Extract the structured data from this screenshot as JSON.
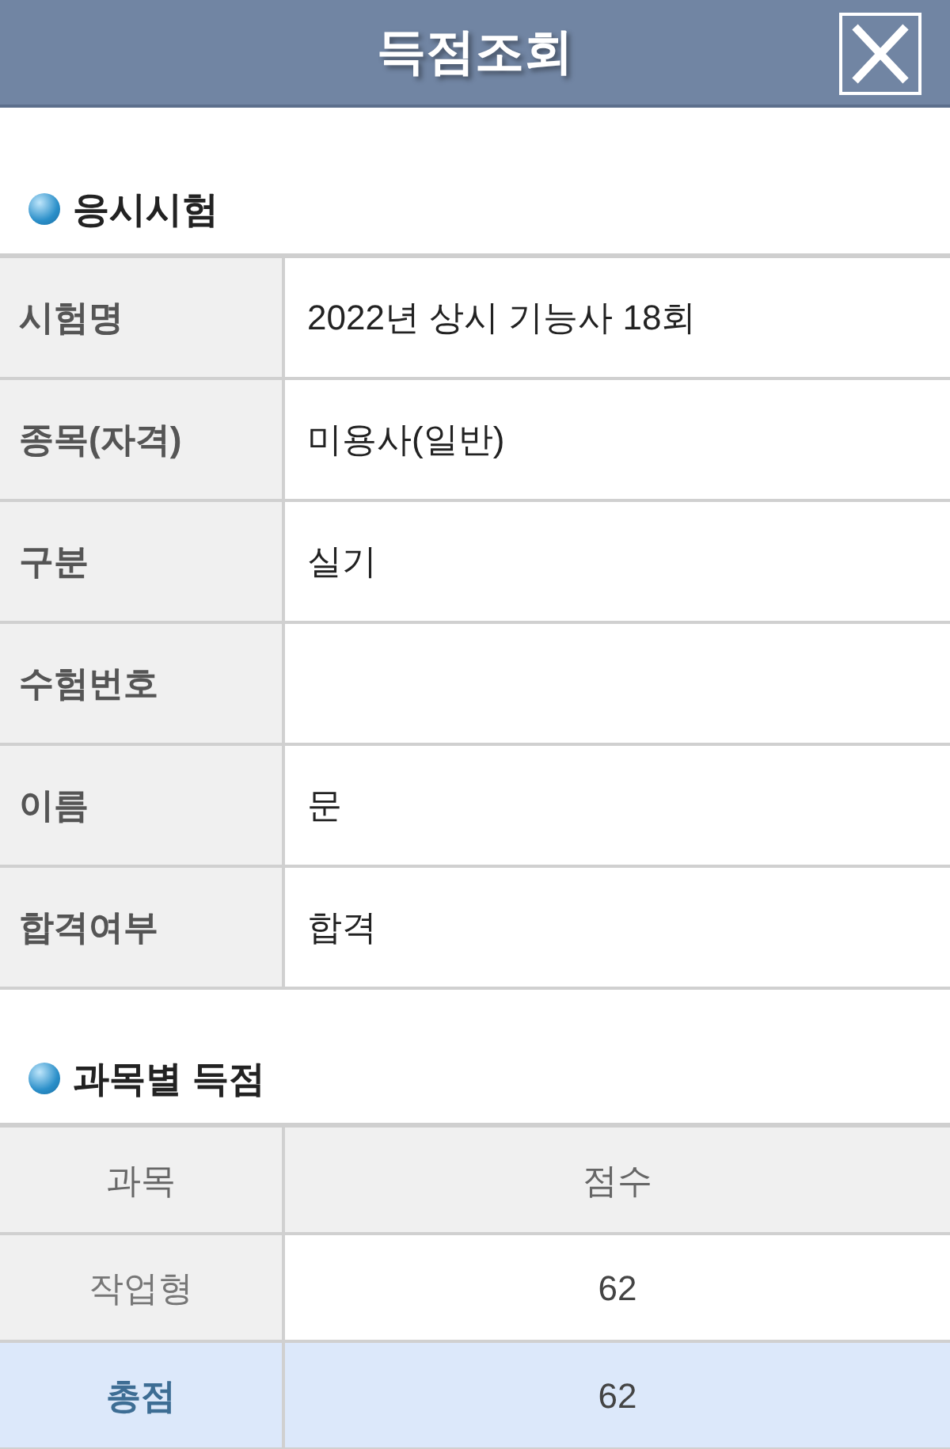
{
  "header": {
    "title": "득점조회"
  },
  "exam_info": {
    "title": "응시시험",
    "rows": [
      {
        "label": "시험명",
        "value": "2022년 상시 기능사 18회"
      },
      {
        "label": "종목(자격)",
        "value": "미용사(일반)"
      },
      {
        "label": "구분",
        "value": "실기"
      },
      {
        "label": "수험번호",
        "value": ""
      },
      {
        "label": "이름",
        "value": "문"
      },
      {
        "label": "합격여부",
        "value": "합격"
      }
    ]
  },
  "scores": {
    "title": "과목별 득점",
    "columns": [
      "과목",
      "점수"
    ],
    "rows": [
      {
        "kind": "subject",
        "subject": "작업형",
        "score": "62"
      },
      {
        "kind": "total",
        "subject": "총점",
        "score": "62"
      }
    ]
  }
}
